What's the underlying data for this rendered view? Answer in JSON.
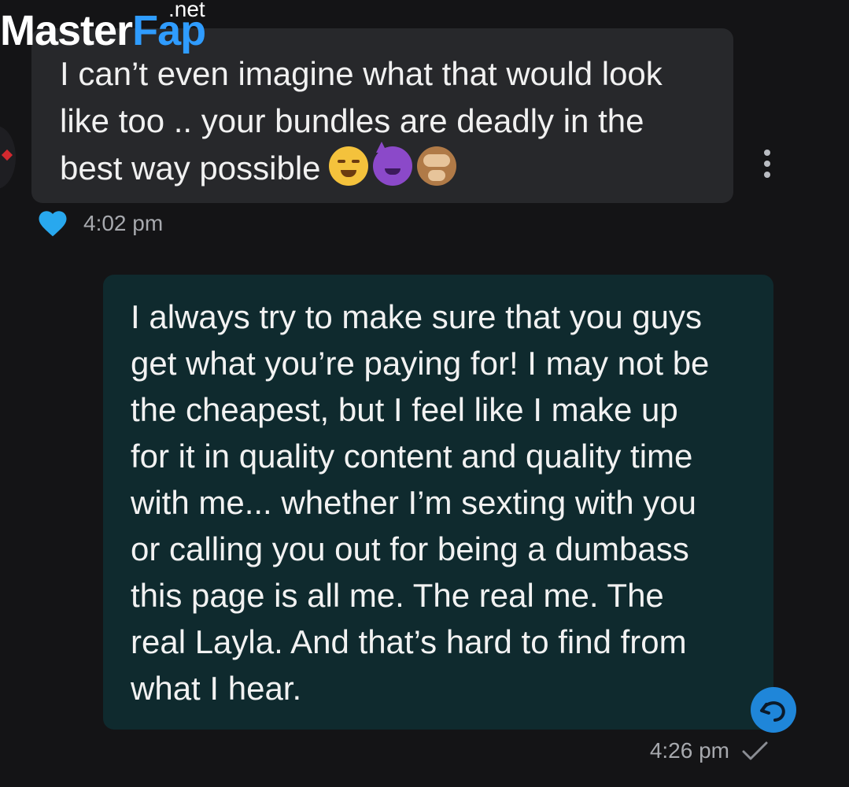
{
  "watermark": {
    "brand_part1": "Master",
    "brand_part2": "Fap",
    "tld": ".net"
  },
  "colors": {
    "background": "#141416",
    "received_bubble": "#27282b",
    "sent_bubble": "#0f2a2e",
    "accent_blue": "#1f86d9",
    "heart_blue": "#28a8ee",
    "brand_blue": "#2f9cff"
  },
  "conversation": {
    "received": {
      "text": "I can’t even imagine what that would look\nlike too .. your bundles are deadly in the\nbest way possible",
      "emojis": [
        "drooling-face",
        "smiling-devil",
        "see-no-evil-monkey"
      ],
      "time": "4:02 pm",
      "reaction": "heart-icon"
    },
    "sent": {
      "text": "I always try to make sure that you guys\nget what you’re paying for! I may not be\nthe cheapest, but I feel like I make up\nfor it in quality content and quality time\nwith me... whether I’m sexting with you\nor calling you out for being a dumbass\nthis page is all me. The real me. The\nreal Layla. And that’s hard to find from\nwhat I hear.",
      "time": "4:26 pm",
      "status_icon": "check-icon"
    }
  }
}
